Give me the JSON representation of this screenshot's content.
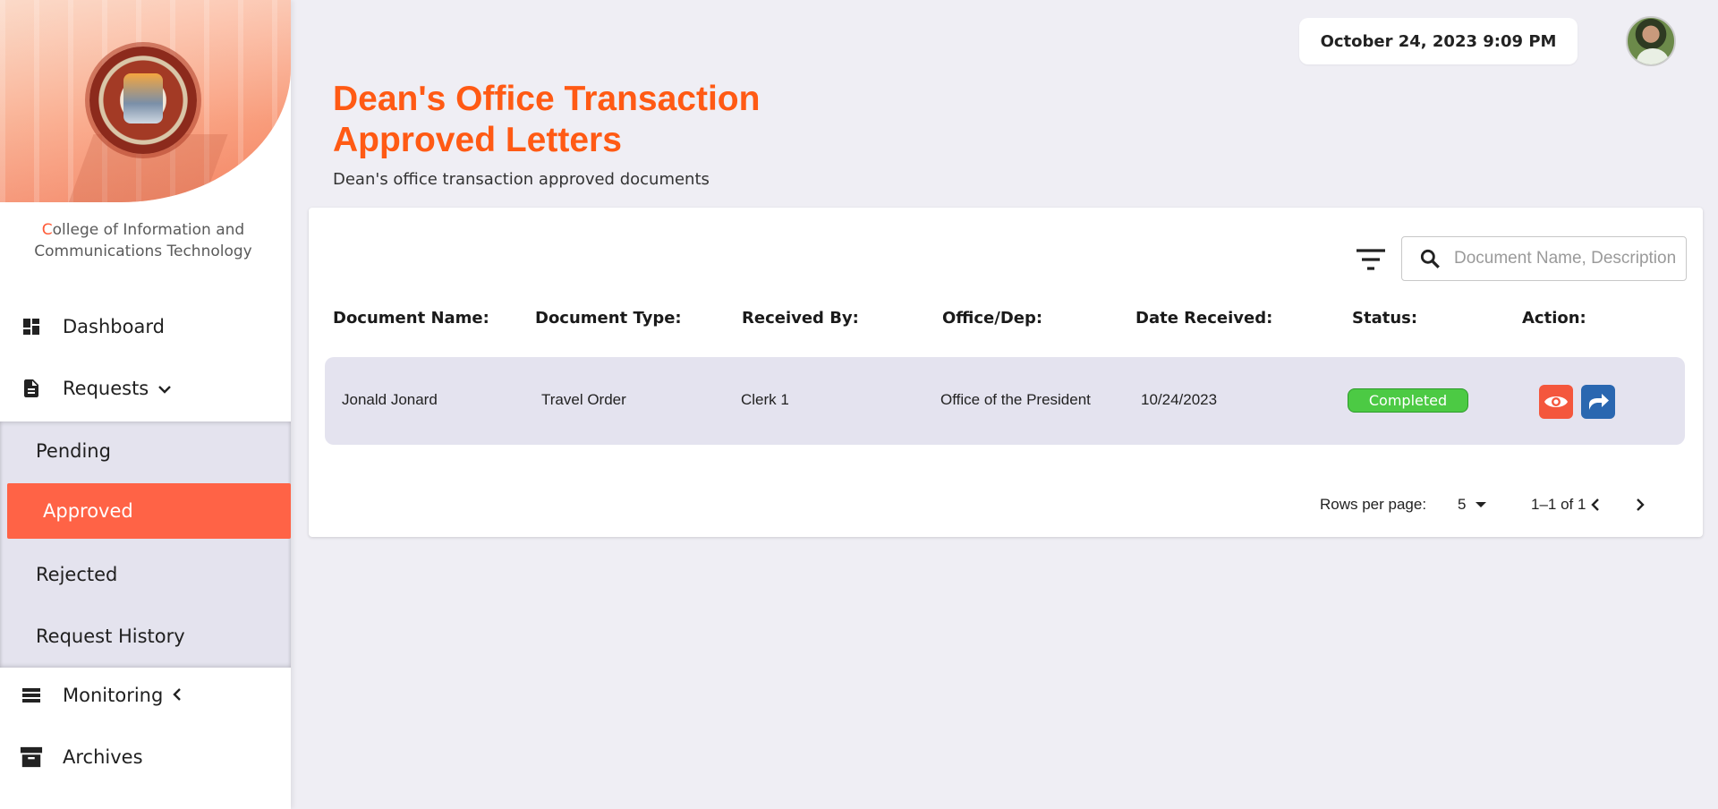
{
  "sidebar": {
    "college_first_letter": "C",
    "college_rest_line1": "ollege of Information and",
    "college_line2": "Communications Technology",
    "items": [
      {
        "label": "Dashboard",
        "icon": "dashboard-icon"
      },
      {
        "label": "Requests",
        "icon": "document-icon"
      },
      {
        "label": "Monitoring",
        "icon": "list-icon"
      },
      {
        "label": "Archives",
        "icon": "archive-icon"
      }
    ],
    "requests_submenu": [
      {
        "label": "Pending"
      },
      {
        "label": "Approved",
        "active": true
      },
      {
        "label": "Rejected"
      },
      {
        "label": "Request History"
      }
    ]
  },
  "header": {
    "datetime": "October 24, 2023 9:09 PM",
    "title_line1": "Dean's Office Transaction",
    "title_line2": "Approved Letters",
    "subtitle": "Dean's office transaction approved documents"
  },
  "search": {
    "placeholder": "Document Name, Description"
  },
  "table": {
    "columns": [
      "Document Name:",
      "Document Type:",
      "Received By:",
      "Office/Dep:",
      "Date Received:",
      "Status:",
      "Action:"
    ],
    "rows": [
      {
        "document_name": "Jonald Jonard",
        "document_type": "Travel Order",
        "received_by": "Clerk 1",
        "office": "Office of the President",
        "date_received": "10/24/2023",
        "status": "Completed"
      }
    ]
  },
  "pagination": {
    "rows_per_page_label": "Rows per page:",
    "rows_per_page": "5",
    "range": "1–1 of 1"
  },
  "colors": {
    "accent": "#ff5a14",
    "active_nav": "#ff6346",
    "status_completed": "#4cca44",
    "view_button": "#f4573d",
    "forward_button": "#2a67b0"
  }
}
